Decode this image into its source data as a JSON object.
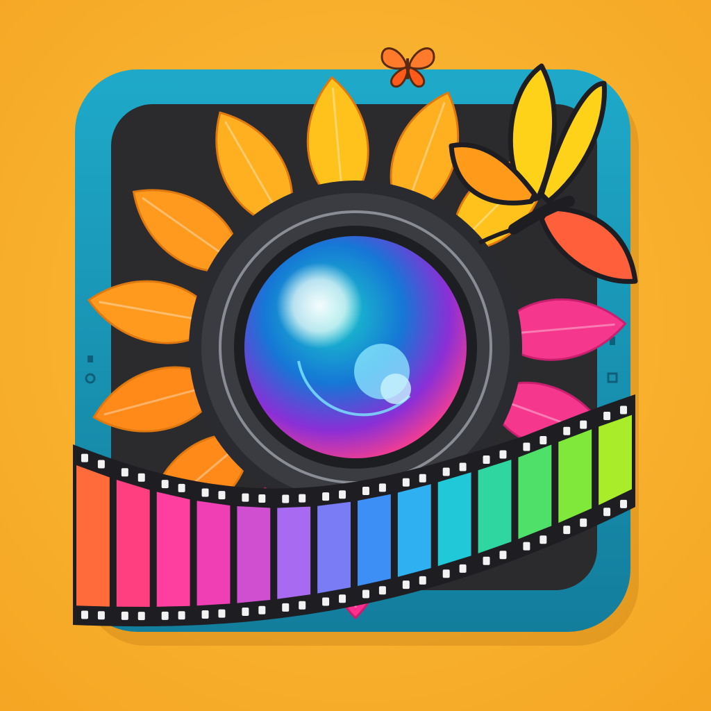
{
  "background": {
    "colors": [
      "#fbbd3a",
      "#f5a623"
    ]
  },
  "app_icon": {
    "name": "photo-video-app-icon",
    "frame_color": "#1fa9c9",
    "frame_edge_color": "#137d9c",
    "screen_color": "#2b2b2e"
  },
  "flower": {
    "petal_colors_warm": [
      "#ffc21c",
      "#ffb020",
      "#ff9a1f",
      "#ff8a1a"
    ],
    "petal_colors_pink": [
      "#ff2f8f",
      "#f5388d"
    ],
    "petal_outline": "#e07810"
  },
  "lens": {
    "ring_color": "#3a3c42",
    "glass_colors": [
      "#1ad0c9",
      "#1677d6",
      "#8a2fd6",
      "#ff3f8a"
    ],
    "highlight_color": "#ffffff"
  },
  "film_strip": {
    "frame_colors": [
      "#ff6b3a",
      "#ff3f7f",
      "#ff3fa0",
      "#f03fb5",
      "#d04fd0",
      "#a86af0",
      "#7a7cf5",
      "#3d8ff5",
      "#2fb0f0",
      "#20c8d8",
      "#2fd6a0",
      "#4fe06a",
      "#7fe83a",
      "#a8ec2a"
    ],
    "edge_color": "#1d1d22"
  },
  "butterflies": {
    "large": {
      "wing_colors": [
        "#ffd21a",
        "#ff9a1a",
        "#ff5f3a"
      ],
      "outline": "#1d1d22"
    },
    "small": {
      "wing_colors": [
        "#ff7a2a",
        "#ff5a1a"
      ],
      "outline": "#5a2a10"
    }
  }
}
